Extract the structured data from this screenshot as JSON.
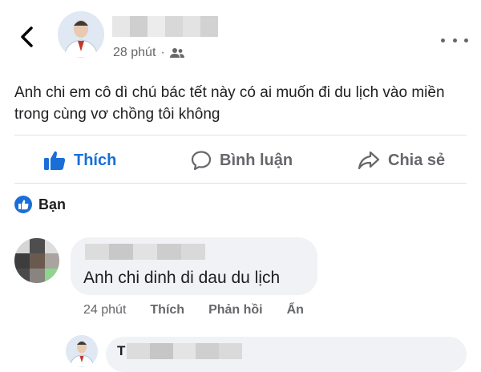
{
  "header": {
    "back_icon": "chevron-left-icon",
    "timestamp": "28 phút",
    "separator": "·",
    "audience_icon": "friends-icon",
    "more_icon": "more-horizontal-icon"
  },
  "post": {
    "text": "Anh chi em cô dì chú bác tết này có ai muốn đi du lịch vào miền trong cùng vơ chồng tôi không"
  },
  "actions": {
    "like_label": "Thích",
    "comment_label": "Bình luận",
    "share_label": "Chia sẻ"
  },
  "friends": {
    "label": "Bạn"
  },
  "comment": {
    "text": "Anh chi dinh di dau du lịch",
    "time": "24 phút",
    "like_label": "Thích",
    "reply_label": "Phản hồi",
    "hide_label": "Ẩn"
  },
  "reply": {
    "name_partial": "T"
  },
  "colors": {
    "accent": "#1a6ed8",
    "secondary_text": "#65676b",
    "bubble": "#f0f2f5",
    "divider": "#dfe1e5"
  }
}
